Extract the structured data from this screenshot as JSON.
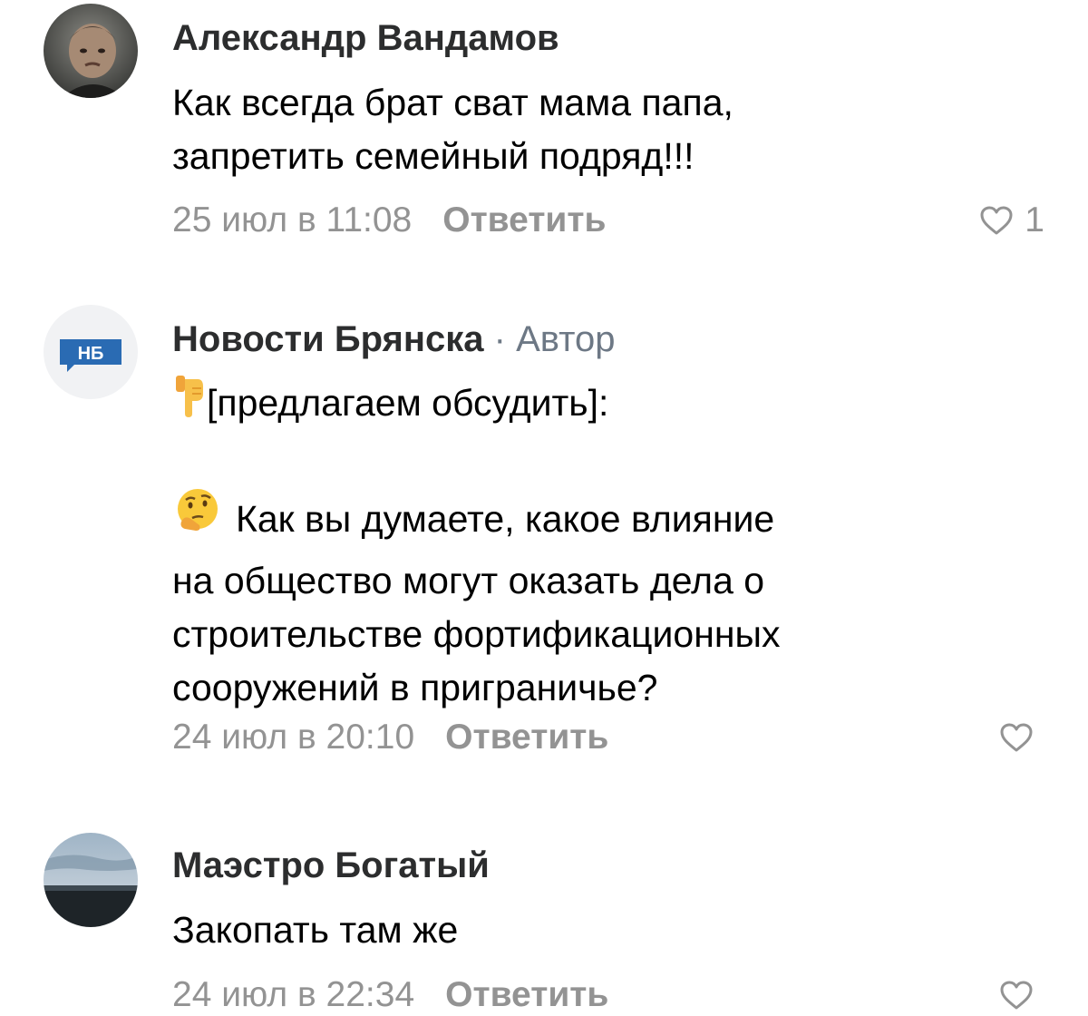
{
  "comments": [
    {
      "author": "Александр Вандамов",
      "role": "",
      "avatar_icon": "user-photo-avatar",
      "lines": [
        "Как всегда брат сват мама папа,",
        "запретить семейный подряд!!!"
      ],
      "date": "25 июл в 11:08",
      "reply_label": "Ответить",
      "likes": "1"
    },
    {
      "author": "Новости Брянска",
      "role_separator": "·",
      "role": "Автор",
      "avatar_icon": "group-logo-avatar",
      "avatar_label": "НБ",
      "intro_emoji": "pointing-down-emoji",
      "intro_text": "[предлагаем обсудить]:",
      "question_emoji": "thinking-face-emoji",
      "question_lines": [
        "Как вы думаете, какое влияние",
        "на общество могут оказать дела о",
        "строительстве фортификационных",
        "сооружений в приграничье?"
      ],
      "date": "24 июл в 20:10",
      "reply_label": "Ответить",
      "likes": ""
    },
    {
      "author": "Маэстро Богатый",
      "role": "",
      "avatar_icon": "landscape-photo-avatar",
      "lines": [
        "Закопать там же"
      ],
      "date": "24 июл в 22:34",
      "reply_label": "Ответить",
      "likes": ""
    }
  ],
  "colors": {
    "meta_gray": "#939393",
    "author_role_gray": "#6d7885",
    "group_logo_blue": "#2a6bb3"
  }
}
